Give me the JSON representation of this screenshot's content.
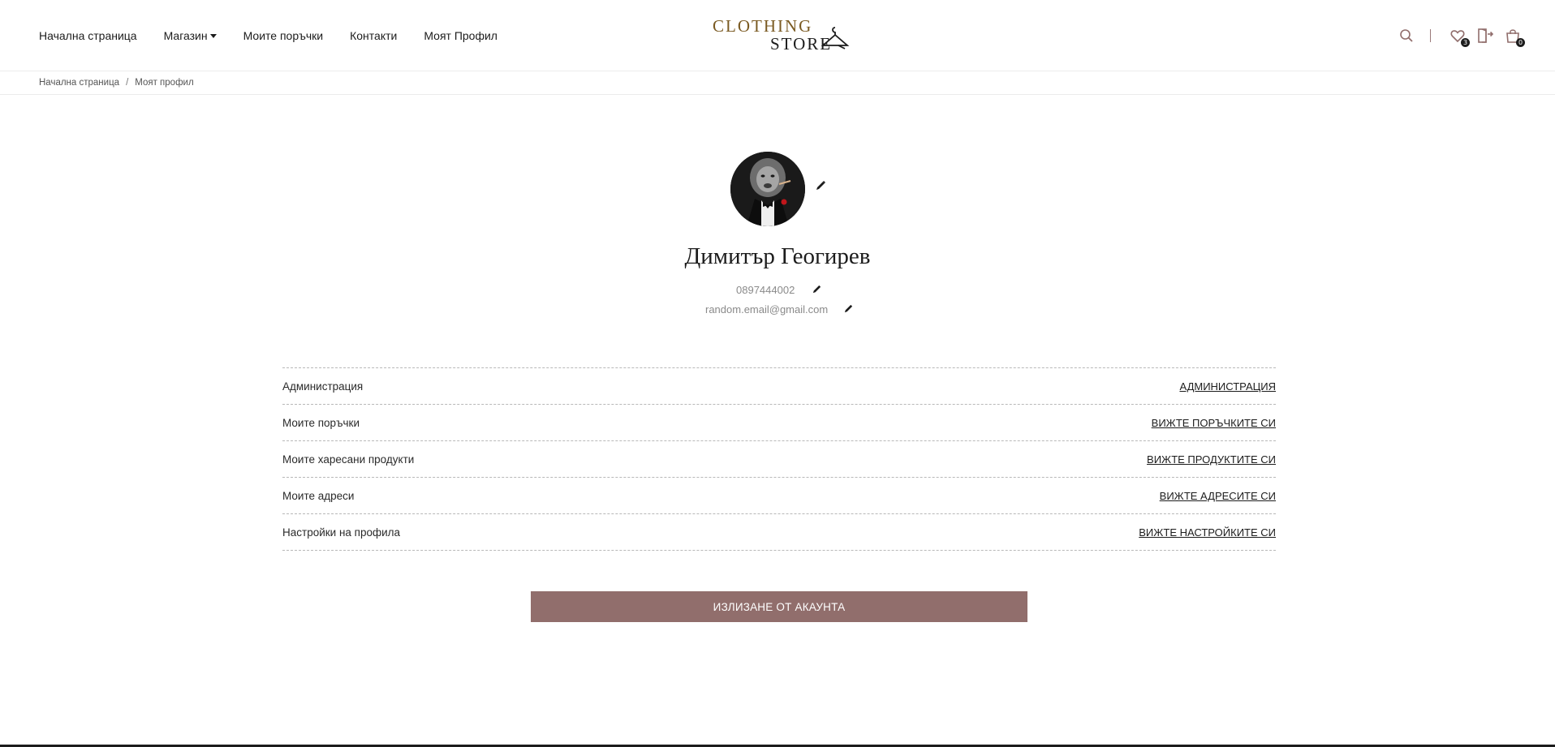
{
  "header": {
    "nav": [
      {
        "label": "Начална страница"
      },
      {
        "label": "Магазин"
      },
      {
        "label": "Моите поръчки"
      },
      {
        "label": "Контакти"
      },
      {
        "label": "Моят Профил"
      }
    ],
    "logo": {
      "line1": "CLOTHING",
      "line2": "STORE"
    },
    "icons": {
      "search": "search-icon",
      "wishlist": "heart-icon",
      "logout": "door-exit-icon",
      "cart": "shopping-bag-icon"
    },
    "wishlist_count": "3",
    "cart_count": "0"
  },
  "breadcrumb": {
    "items": [
      "Начална страница",
      "Моят профил"
    ],
    "separator": "/"
  },
  "profile": {
    "name": "Димитър Геогирев",
    "phone": "0897444002",
    "email": "random.email@gmail.com"
  },
  "account_rows": [
    {
      "label": "Администрация",
      "link": "Администрация"
    },
    {
      "label": "Моите поръчки",
      "link": "Вижте поръчките си"
    },
    {
      "label": "Моите харесани продукти",
      "link": "Вижте продуктите си"
    },
    {
      "label": "Моите адреси",
      "link": "Вижте адресите си"
    },
    {
      "label": "Настройки на профила",
      "link": "Вижте настройките си"
    }
  ],
  "logout_label": "ИЗЛИЗАНЕ ОТ АКАУНТА",
  "colors": {
    "accent": "#916e6c",
    "logo_gold": "#7a5a22",
    "text_dark": "#1c1c1c",
    "muted": "#8a8a8a"
  }
}
